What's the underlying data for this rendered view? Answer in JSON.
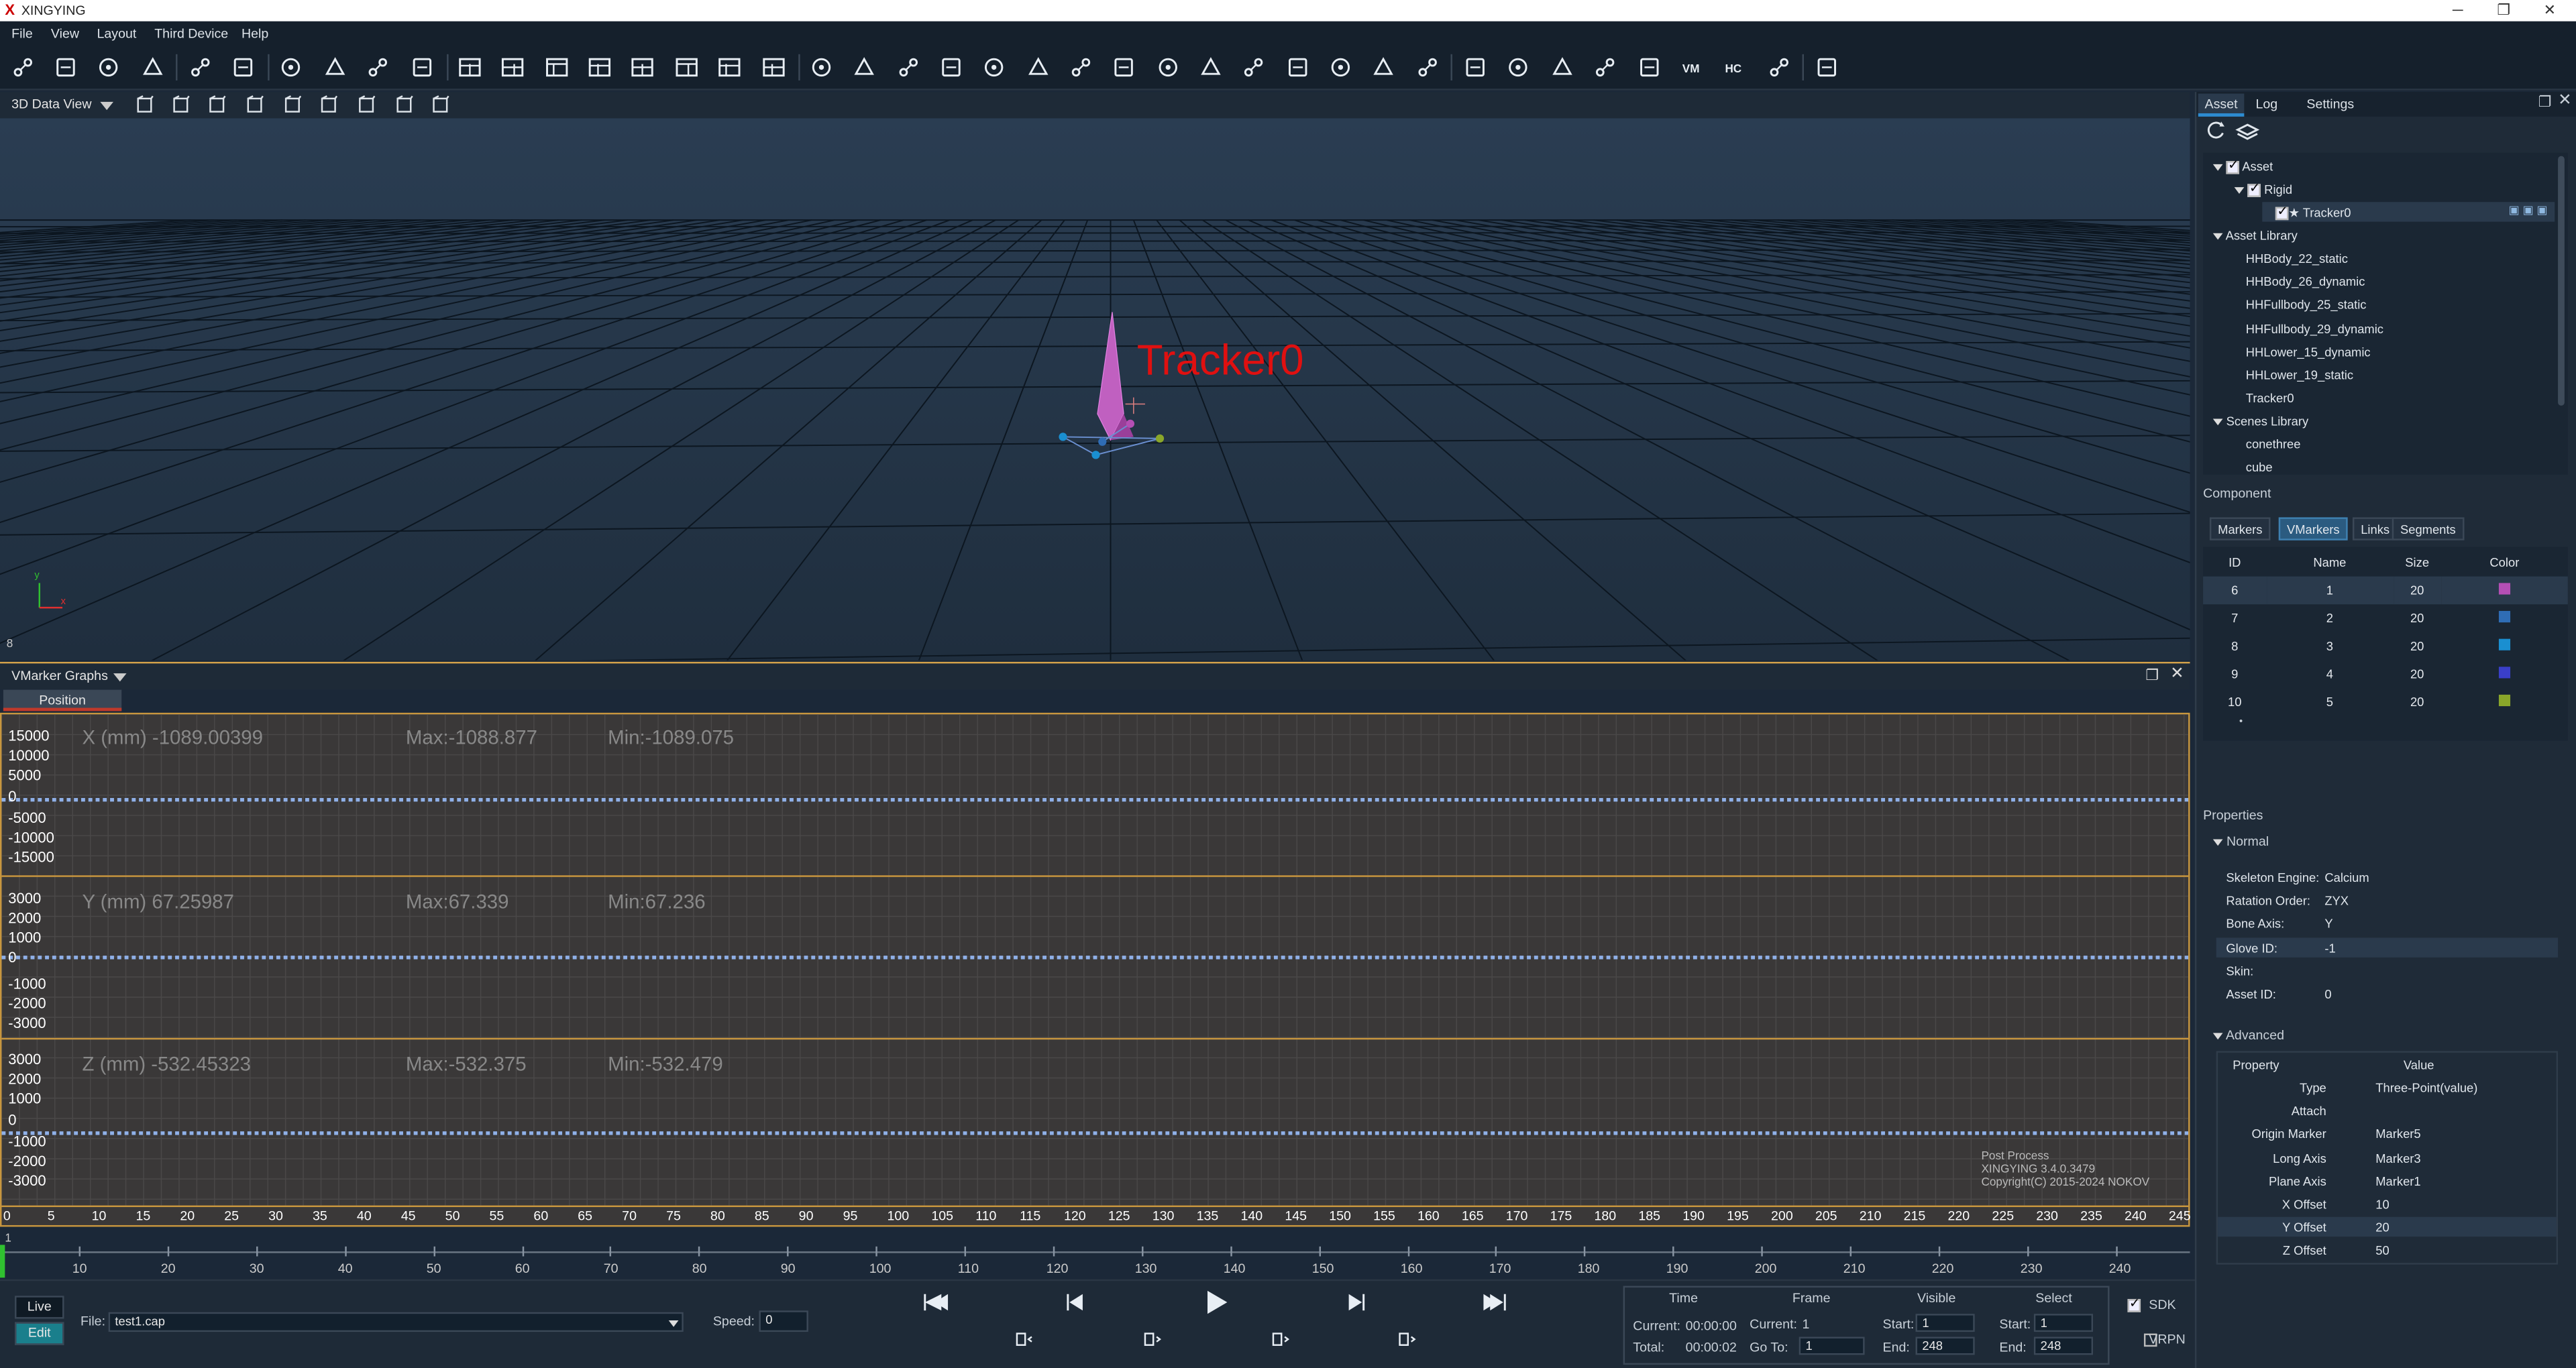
{
  "app": {
    "title": "XINGYING",
    "logo": "X"
  },
  "window_controls": {
    "minimize": "─",
    "maximize": "❐",
    "close": "✕"
  },
  "menu": [
    "File",
    "View",
    "Layout",
    "Third Device",
    "Help"
  ],
  "view": {
    "mode": "3D Data View",
    "tracker_label": "Tracker0",
    "axis_x": "x",
    "axis_y": "y",
    "corner_number": "8"
  },
  "graph_panel": {
    "title": "VMarker Graphs",
    "tab": "Position",
    "x": {
      "label": "X (mm) -1089.00399",
      "max": "Max:-1088.877",
      "min": "Min:-1089.075",
      "ticks": [
        "15000",
        "10000",
        "5000",
        "0",
        "-5000",
        "-10000",
        "-15000"
      ]
    },
    "y": {
      "label": "Y (mm) 67.25987",
      "max": "Max:67.339",
      "min": "Min:67.236",
      "ticks": [
        "3000",
        "2000",
        "1000",
        "0",
        "-1000",
        "-2000",
        "-3000"
      ]
    },
    "z": {
      "label": "Z (mm) -532.45323",
      "max": "Max:-532.375",
      "min": "Min:-532.479",
      "ticks": [
        "3000",
        "2000",
        "1000",
        "0",
        "-1000",
        "-2000",
        "-3000"
      ]
    },
    "x_axis_ticks": [
      "0",
      "5",
      "10",
      "15",
      "20",
      "25",
      "30",
      "35",
      "40",
      "45",
      "50",
      "55",
      "60",
      "65",
      "70",
      "75",
      "80",
      "85",
      "90",
      "95",
      "100",
      "105",
      "110",
      "115",
      "120",
      "125",
      "130",
      "135",
      "140",
      "145",
      "150",
      "155",
      "160",
      "165",
      "170",
      "175",
      "180",
      "185",
      "190",
      "195",
      "200",
      "205",
      "210",
      "215",
      "220",
      "225",
      "230",
      "235",
      "240",
      "245"
    ],
    "watermark": {
      "line1": "Post Process",
      "line2": "XINGYING 3.4.0.3479",
      "line3": "Copyright(C) 2015-2024 NOKOV"
    }
  },
  "frame_ruler": {
    "start_label": "1",
    "ticks": [
      "10",
      "20",
      "30",
      "40",
      "50",
      "60",
      "70",
      "80",
      "90",
      "100",
      "110",
      "120",
      "130",
      "140",
      "150",
      "160",
      "170",
      "180",
      "190",
      "200",
      "210",
      "220",
      "230",
      "240"
    ]
  },
  "bottom": {
    "live": "Live",
    "edit": "Edit",
    "file_label": "File:",
    "file_value": "test1.cap",
    "speed_label": "Speed:",
    "speed_value": "0",
    "time": {
      "header": "Time",
      "current_label": "Current:",
      "current_value": "00:00:00",
      "total_label": "Total:",
      "total_value": "00:00:02"
    },
    "frame": {
      "header": "Frame",
      "current_label": "Current:",
      "current_value": "1",
      "goto_label": "Go To:",
      "goto_value": "1"
    },
    "visible": {
      "header": "Visible",
      "start_label": "Start:",
      "start_value": "1",
      "end_label": "End:",
      "end_value": "248"
    },
    "select": {
      "header": "Select",
      "start_label": "Start:",
      "start_value": "1",
      "end_label": "End:",
      "end_value": "248"
    },
    "sdk": "SDK",
    "vrpn": "VRPN"
  },
  "right": {
    "tabs": [
      "Asset",
      "Log",
      "Settings"
    ],
    "tree": {
      "asset": "Asset",
      "rigid": "Rigid",
      "tracker": "Tracker0",
      "asset_library": "Asset Library",
      "library_items": [
        "HHBody_22_static",
        "HHBody_26_dynamic",
        "HHFullbody_25_static",
        "HHFullbody_29_dynamic",
        "HHLower_15_dynamic",
        "HHLower_19_static",
        "Tracker0"
      ],
      "scenes_library": "Scenes Library",
      "scenes": [
        "conethree",
        "cube"
      ]
    },
    "component": {
      "title": "Component",
      "tabs": [
        "Markers",
        "VMarkers",
        "Links",
        "Segments"
      ],
      "headers": [
        "ID",
        "Name",
        "Size",
        "Color"
      ],
      "rows": [
        {
          "id": "6",
          "name": "1",
          "size": "20",
          "color": "#b44fb4"
        },
        {
          "id": "7",
          "name": "2",
          "size": "20",
          "color": "#2f6db5"
        },
        {
          "id": "8",
          "name": "3",
          "size": "20",
          "color": "#1a8fd1"
        },
        {
          "id": "9",
          "name": "4",
          "size": "20",
          "color": "#3a3fc9"
        },
        {
          "id": "10",
          "name": "5",
          "size": "20",
          "color": "#8aa62a"
        }
      ]
    },
    "properties": {
      "title": "Properties",
      "normal": "Normal",
      "normal_items": [
        {
          "k": "Skeleton Engine:",
          "v": "Calcium"
        },
        {
          "k": "Ratation Order:",
          "v": "ZYX"
        },
        {
          "k": "Bone Axis:",
          "v": "Y"
        },
        {
          "k": "Glove ID:",
          "v": "-1"
        },
        {
          "k": "Skin:",
          "v": ""
        },
        {
          "k": "Asset ID:",
          "v": "0"
        }
      ],
      "advanced": "Advanced",
      "adv_headers": [
        "Property",
        "Value"
      ],
      "adv_items": [
        {
          "k": "Type",
          "v": "Three-Point(value)"
        },
        {
          "k": "Attach",
          "v": ""
        },
        {
          "k": "Origin Marker",
          "v": "Marker5"
        },
        {
          "k": "Long Axis",
          "v": "Marker3"
        },
        {
          "k": "Plane Axis",
          "v": "Marker1"
        },
        {
          "k": "X Offset",
          "v": "10"
        },
        {
          "k": "Y Offset",
          "v": "20"
        },
        {
          "k": "Z Offset",
          "v": "50"
        }
      ]
    }
  },
  "icons": [
    "folder-open-icon",
    "import-icon",
    "capture-icon",
    "save-icon",
    "visibility-icon",
    "calibrate-icon",
    "layers-icon",
    "eye-icon",
    "edit-icon",
    "settings-icon",
    "layout-1-icon",
    "layout-2-icon",
    "layout-3-icon",
    "layout-4-icon",
    "layout-5-icon",
    "layout-6-icon",
    "layout-7-icon",
    "layout-8-icon",
    "link-icon",
    "merge-icon",
    "fill-gap-icon",
    "cut-icon",
    "smooth-icon",
    "connect-icon",
    "calculator-icon",
    "circle-icon",
    "delete-icon",
    "filter-icon",
    "trim-icon",
    "frame-select-icon",
    "target-icon",
    "skeleton-icon",
    "undo-icon",
    "camera-icon",
    "rigid-icon",
    "speed-icon",
    "share-icon",
    "chart-icon",
    "vm-icon",
    "hc-icon",
    "doc-icon",
    "axis-icon"
  ]
}
